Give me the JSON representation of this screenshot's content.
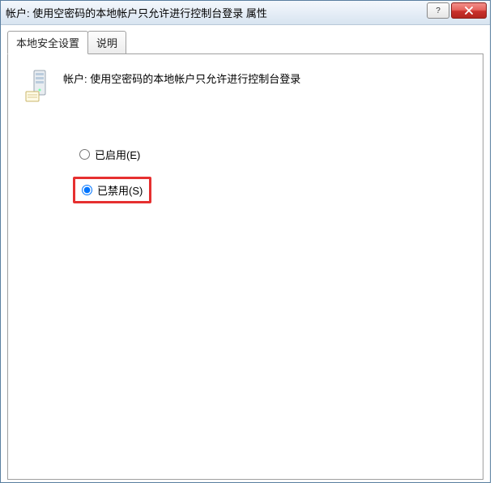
{
  "titlebar": {
    "text": "帐户: 使用空密码的本地帐户只允许进行控制台登录 属性"
  },
  "tabs": {
    "security": "本地安全设置",
    "description": "说明"
  },
  "policy": {
    "title": "帐户: 使用空密码的本地帐户只允许进行控制台登录"
  },
  "options": {
    "enabled": "已启用(E)",
    "disabled": "已禁用(S)"
  }
}
